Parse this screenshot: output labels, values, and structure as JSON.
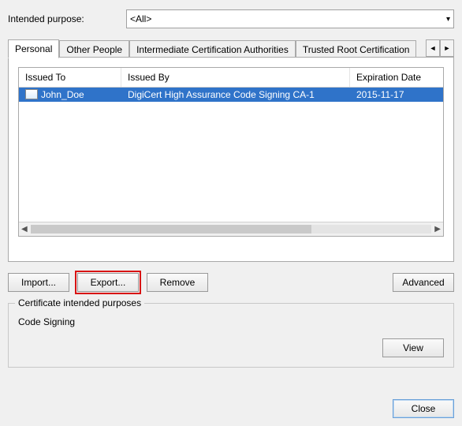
{
  "purpose": {
    "label": "Intended purpose:",
    "selected": "<All>"
  },
  "tabs": [
    {
      "label": "Personal",
      "active": true
    },
    {
      "label": "Other People",
      "active": false
    },
    {
      "label": "Intermediate Certification Authorities",
      "active": false
    },
    {
      "label": "Trusted Root Certification",
      "active": false
    }
  ],
  "list": {
    "columns": {
      "issued_to": "Issued To",
      "issued_by": "Issued By",
      "expiration": "Expiration Date"
    },
    "rows": [
      {
        "issued_to": "John_Doe",
        "issued_by": "DigiCert High Assurance Code Signing CA-1",
        "expiration": "2015-11-17",
        "selected": true
      }
    ]
  },
  "buttons": {
    "import": "Import...",
    "export": "Export...",
    "remove": "Remove",
    "advanced": "Advanced",
    "view": "View",
    "close": "Close"
  },
  "group": {
    "title": "Certificate intended purposes",
    "value": "Code Signing"
  }
}
